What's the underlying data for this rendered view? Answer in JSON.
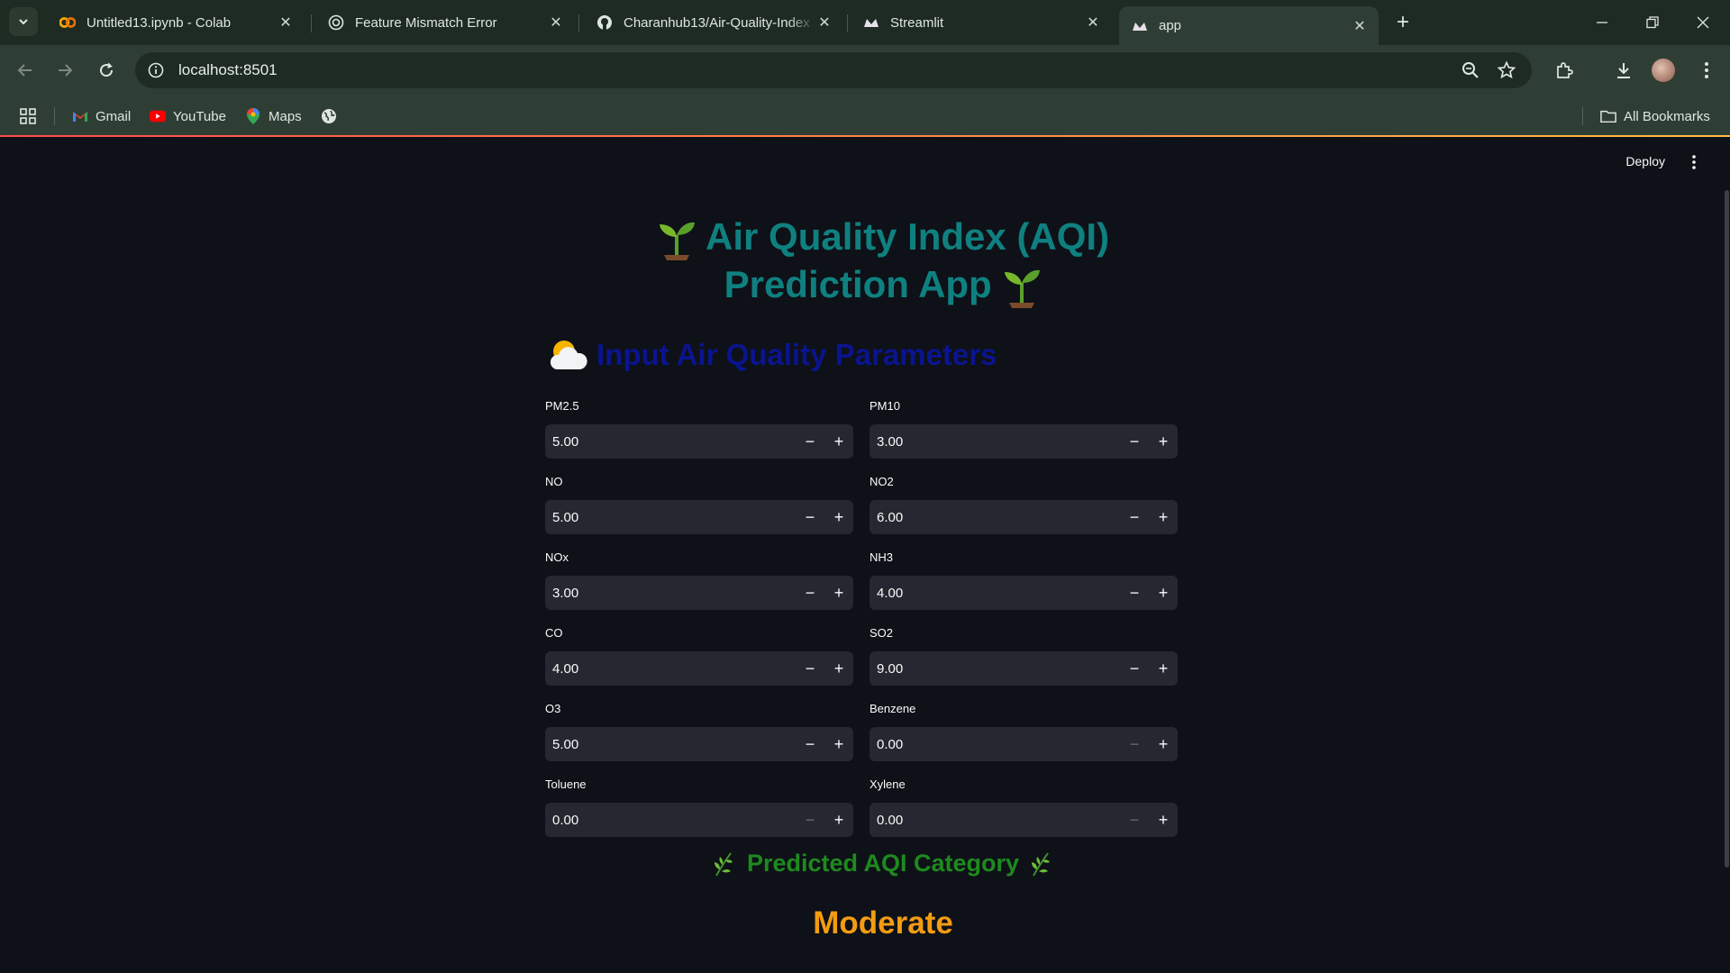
{
  "browser": {
    "tabs": [
      {
        "title": "Untitled13.ipynb - Colab",
        "icon": "colab-icon"
      },
      {
        "title": "Feature Mismatch Error",
        "icon": "openai-icon"
      },
      {
        "title": "Charanhub13/Air-Quality-Index",
        "icon": "github-icon"
      },
      {
        "title": "Streamlit",
        "icon": "streamlit-icon"
      },
      {
        "title": "app",
        "icon": "streamlit-icon",
        "active": true
      }
    ],
    "url": "localhost:8501",
    "bookmarks": [
      {
        "label": "Gmail",
        "icon": "gmail-icon"
      },
      {
        "label": "YouTube",
        "icon": "youtube-icon"
      },
      {
        "label": "Maps",
        "icon": "maps-icon"
      }
    ],
    "all_bookmarks": "All Bookmarks"
  },
  "app": {
    "deploy_label": "Deploy",
    "title_line1": "Air Quality Index (AQI)",
    "title_line2": "Prediction App",
    "input_heading": "Input Air Quality Parameters",
    "fields": [
      {
        "label": "PM2.5",
        "value": "5.00",
        "minus_enabled": true
      },
      {
        "label": "PM10",
        "value": "3.00",
        "minus_enabled": true
      },
      {
        "label": "NO",
        "value": "5.00",
        "minus_enabled": true
      },
      {
        "label": "NO2",
        "value": "6.00",
        "minus_enabled": true
      },
      {
        "label": "NOx",
        "value": "3.00",
        "minus_enabled": true
      },
      {
        "label": "NH3",
        "value": "4.00",
        "minus_enabled": true
      },
      {
        "label": "CO",
        "value": "4.00",
        "minus_enabled": true
      },
      {
        "label": "SO2",
        "value": "9.00",
        "minus_enabled": true
      },
      {
        "label": "O3",
        "value": "5.00",
        "minus_enabled": true
      },
      {
        "label": "Benzene",
        "value": "0.00",
        "minus_enabled": false
      },
      {
        "label": "Toluene",
        "value": "0.00",
        "minus_enabled": false
      },
      {
        "label": "Xylene",
        "value": "0.00",
        "minus_enabled": false
      }
    ],
    "prediction_heading": "Predicted AQI Category",
    "prediction_value": "Moderate",
    "colors": {
      "title": "#0f8080",
      "input_heading": "#0b148f",
      "prediction_heading": "#1e8a1e",
      "prediction_value": "#f39c12",
      "background": "#0e1117"
    }
  }
}
